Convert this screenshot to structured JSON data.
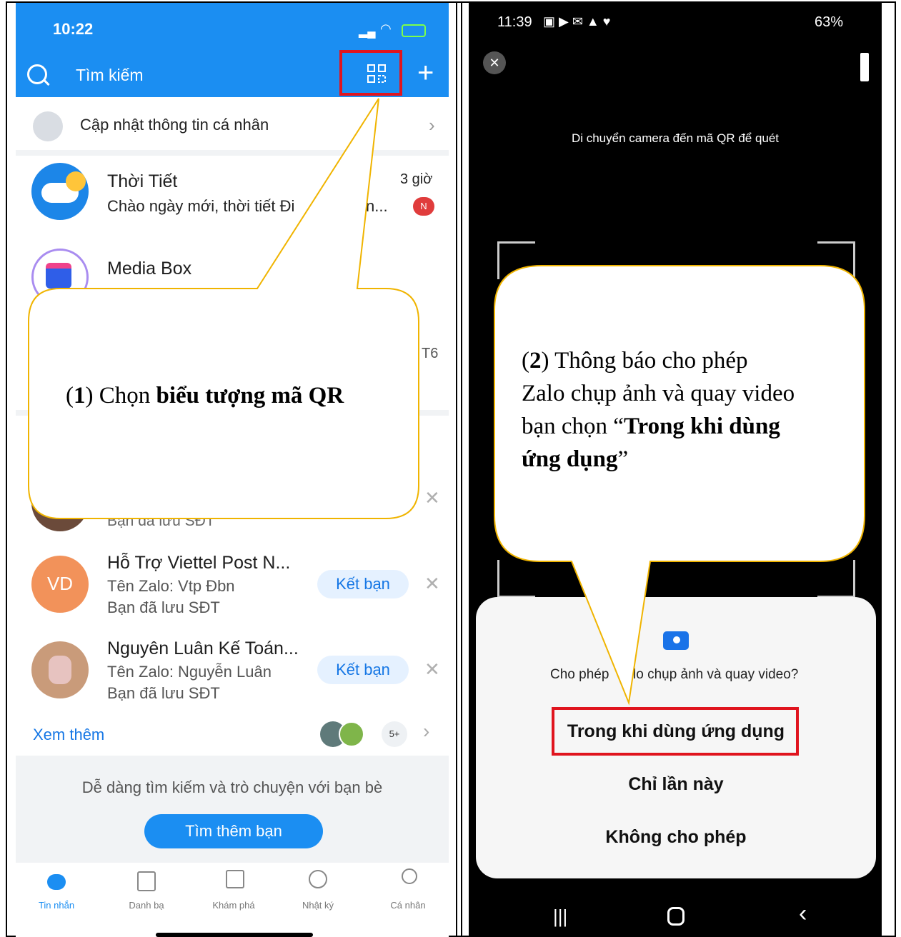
{
  "left_phone": {
    "status_time": "10:22",
    "search_placeholder": "Tìm kiếm",
    "update_profile": "Cập nhật thông tin cá nhân",
    "chats": [
      {
        "name": "Thời Tiết",
        "preview": "Chào ngày mới, thời tiết Đi",
        "preview_tail": "n...",
        "time": "3 giờ",
        "badge": "N"
      },
      {
        "name": "Media Box",
        "preview": "",
        "time": ""
      }
    ],
    "partial_time": "T6",
    "suggestions": [
      {
        "initials": "VD",
        "name": "Hỗ Trợ Viettel Post N...",
        "zalo": "Tên Zalo: Vtp Đbn",
        "saved": "Bạn đã lưu SĐT",
        "action": "Kết bạn"
      },
      {
        "initials": "",
        "name": "Nguyên Luân Kế Toán...",
        "zalo": "Tên Zalo: Nguyễn Luân",
        "saved": "Bạn đã lưu SĐT",
        "action": "Kết bạn"
      }
    ],
    "partial_saved": "Bạn đã lưu SĐT",
    "see_more": "Xem thêm",
    "see_more_count": "5+",
    "promo_text": "Dễ dàng tìm kiếm và trò chuyện với bạn bè",
    "find_friends": "Tìm thêm bạn",
    "nav": [
      {
        "label": "Tin nhắn",
        "icon": "chat-icon"
      },
      {
        "label": "Danh bạ",
        "icon": "contacts-icon"
      },
      {
        "label": "Khám phá",
        "icon": "discover-icon"
      },
      {
        "label": "Nhật ký",
        "icon": "clock-icon"
      },
      {
        "label": "Cá nhân",
        "icon": "person-icon"
      }
    ],
    "callout": {
      "prefix": "(",
      "step": "1",
      "text": ") Chọn ",
      "bold": "biểu tượng mã QR"
    }
  },
  "right_phone": {
    "status_time": "11:39",
    "battery": "63%",
    "scan_hint": "Di chuyển camera đến mã QR để quét",
    "dialog_question_a": "Cho phép",
    "dialog_question_b": "lo chụp ảnh và quay video?",
    "options": [
      "Trong khi dùng ứng dụng",
      "Chỉ lần này",
      "Không cho phép"
    ],
    "callout": {
      "prefix": "(",
      "step": "2",
      "line1": ") Thông báo cho phép",
      "line2": "Zalo chụp ảnh và quay video",
      "line3a": "bạn chọn “",
      "line3b": "Trong khi dùng",
      "line4b": "ứng dụng",
      "line4c": "”"
    }
  },
  "colors": {
    "zalo_blue": "#1b8ef2",
    "highlight_red": "#e0141e",
    "callout_border": "#f0b400"
  }
}
